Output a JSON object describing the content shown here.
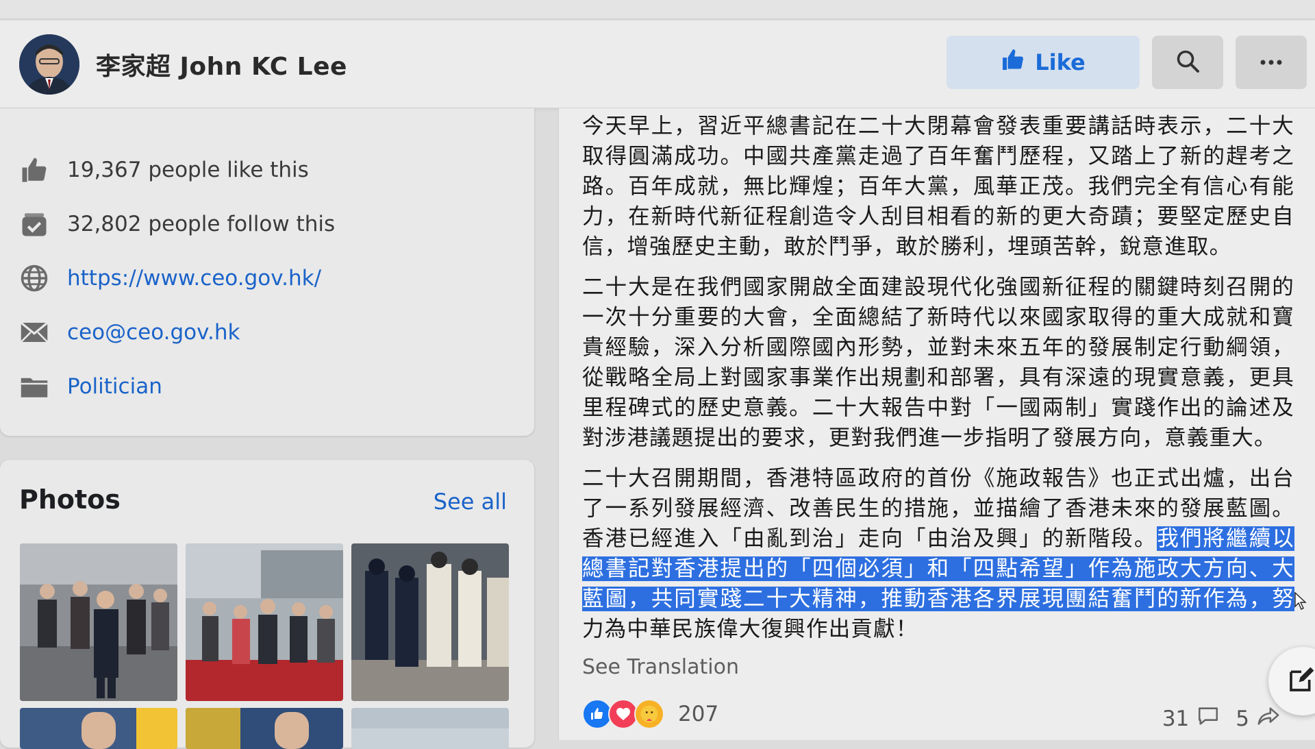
{
  "page": {
    "name": "李家超 John KC Lee",
    "like_label": "Like"
  },
  "about": {
    "items": [
      {
        "icon": "thumbs-up-icon",
        "text": "19,367 people like this",
        "link": false
      },
      {
        "icon": "follow-check-icon",
        "text": "32,802 people follow this",
        "link": false
      },
      {
        "icon": "globe-icon",
        "text": "https://www.ceo.gov.hk/",
        "link": true
      },
      {
        "icon": "envelope-icon",
        "text": "ceo@ceo.gov.hk",
        "link": true
      },
      {
        "icon": "folder-icon",
        "text": "Politician",
        "link": true
      }
    ]
  },
  "photos": {
    "title": "Photos",
    "see_all": "See all"
  },
  "post": {
    "paragraphs": [
      "今天早上，習近平總書記在二十大閉幕會發表重要講話時表示，二十大取得圓滿成功。中國共產黨走過了百年奮鬥歷程，又踏上了新的趕考之路。百年成就，無比輝煌；百年大黨，風華正茂。我們完全有信心有能力，在新時代新征程創造令人刮目相看的新的更大奇蹟；要堅定歷史自信，增強歷史主動，敢於鬥爭，敢於勝利，埋頭苦幹，銳意進取。",
      "二十大是在我們國家開啟全面建設現代化強國新征程的關鍵時刻召開的一次十分重要的大會，全面總結了新時代以來國家取得的重大成就和寶貴經驗，深入分析國際國內形勢，並對未來五年的發展制定行動綱領，從戰略全局上對國家事業作出規劃和部署，具有深遠的現實意義，更具里程碑式的歷史意義。二十大報告中對「一國兩制」實踐作出的論述及對涉港議題提出的要求，更對我們進一步指明了發展方向，意義重大。"
    ],
    "paragraph3_before": "二十大召開期間，香港特區政府的首份《施政報告》也正式出爐，出台了一系列發展經濟、改善民生的措施，並描繪了香港未來的發展藍圖。香港已經進入「由亂到治」走向「由治及興」的新階段。",
    "paragraph3_highlight": "我們將繼續以總書記對香港提出的「四個必須」和「四點希望」作為施政大方向、大藍圖，共同實踐二十大精神，推動香港各界展現團結奮鬥的新作為，努",
    "paragraph3_after": "力為中華民族偉大復興作出貢獻！",
    "see_translation": "See Translation",
    "reaction_count": "207",
    "comment_count": "31",
    "share_count": "5"
  },
  "colors": {
    "accent": "#1a63c9",
    "highlight": "#2d6fe0"
  }
}
